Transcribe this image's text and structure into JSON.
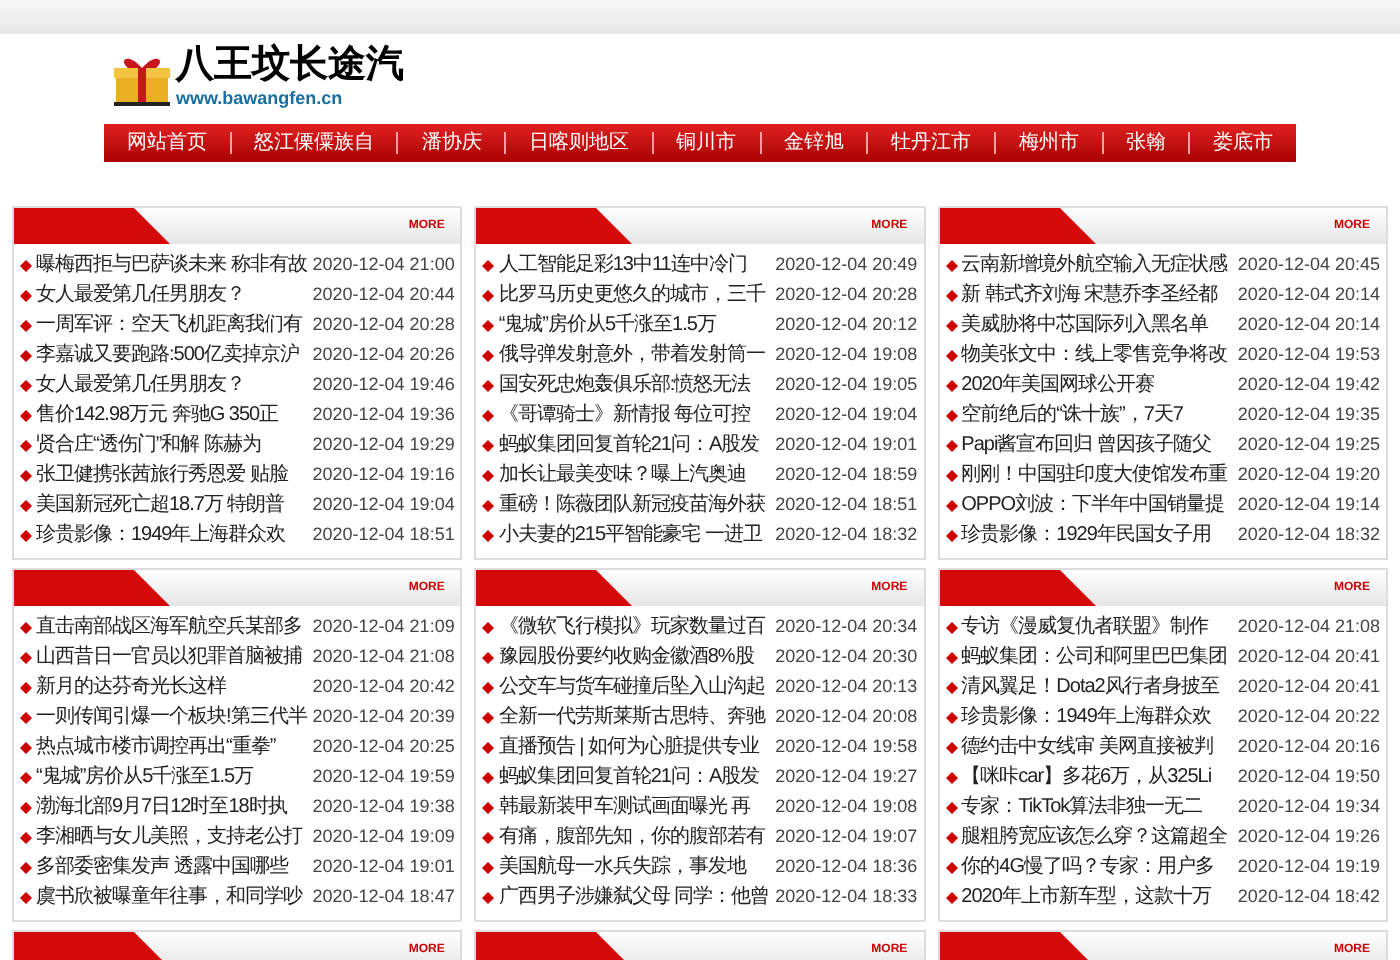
{
  "logo": {
    "title": "八王坟长途汽",
    "url": "www.bawangfen.cn"
  },
  "nav": [
    "网站首页",
    "怒江傈僳族自",
    "潘协庆",
    "日喀则地区",
    "铜川市",
    "金锌旭",
    "牡丹江市",
    "梅州市",
    "张翰",
    "娄底市"
  ],
  "panels": [
    {
      "more": "MORE",
      "items": [
        {
          "title": "曝梅西拒与巴萨谈未来 称非有故",
          "time": "2020-12-04 21:00"
        },
        {
          "title": "女人最爱第几任男朋友？",
          "time": "2020-12-04 20:44"
        },
        {
          "title": "一周军评：空天飞机距离我们有",
          "time": "2020-12-04 20:28"
        },
        {
          "title": "李嘉诚又要跑路:500亿卖掉京沪",
          "time": "2020-12-04 20:26"
        },
        {
          "title": "女人最爱第几任男朋友？",
          "time": "2020-12-04 19:46"
        },
        {
          "title": "售价142.98万元 奔驰G 350正",
          "time": "2020-12-04 19:36"
        },
        {
          "title": "贤合庄“透伤门”和解 陈赫为",
          "time": "2020-12-04 19:29"
        },
        {
          "title": "张卫健携张茜旅行秀恩爱 贴脸",
          "time": "2020-12-04 19:16"
        },
        {
          "title": "美国新冠死亡超18.7万 特朗普",
          "time": "2020-12-04 19:04"
        },
        {
          "title": "珍贵影像：1949年上海群众欢",
          "time": "2020-12-04 18:51"
        }
      ]
    },
    {
      "more": "MORE",
      "items": [
        {
          "title": "人工智能足彩13中11连中冷门",
          "time": "2020-12-04 20:49"
        },
        {
          "title": "比罗马历史更悠久的城市，三千",
          "time": "2020-12-04 20:28"
        },
        {
          "title": "“鬼城”房价从5千涨至1.5万",
          "time": "2020-12-04 20:12"
        },
        {
          "title": "俄导弹发射意外，带着发射筒一",
          "time": "2020-12-04 19:08"
        },
        {
          "title": "国安死忠炮轰俱乐部:愤怒无法",
          "time": "2020-12-04 19:05"
        },
        {
          "title": "《哥谭骑士》新情报 每位可控",
          "time": "2020-12-04 19:04"
        },
        {
          "title": "蚂蚁集团回复首轮21问：A股发",
          "time": "2020-12-04 19:01"
        },
        {
          "title": "加长让最美变味？曝上汽奥迪",
          "time": "2020-12-04 18:59"
        },
        {
          "title": "重磅！陈薇团队新冠疫苗海外获",
          "time": "2020-12-04 18:51"
        },
        {
          "title": "小夫妻的215平智能豪宅 一进卫",
          "time": "2020-12-04 18:32"
        }
      ]
    },
    {
      "more": "MORE",
      "items": [
        {
          "title": "云南新增境外航空输入无症状感",
          "time": "2020-12-04 20:45"
        },
        {
          "title": "新 韩式齐刘海 宋慧乔李圣经都",
          "time": "2020-12-04 20:14"
        },
        {
          "title": "美威胁将中芯国际列入黑名单",
          "time": "2020-12-04 20:14"
        },
        {
          "title": "物美张文中：线上零售竞争将改",
          "time": "2020-12-04 19:53"
        },
        {
          "title": "2020年美国网球公开赛",
          "time": "2020-12-04 19:42"
        },
        {
          "title": "空前绝后的“诛十族”，7天7",
          "time": "2020-12-04 19:35"
        },
        {
          "title": "Papi酱宣布回归 曾因孩子随父",
          "time": "2020-12-04 19:25"
        },
        {
          "title": "刚刚！中国驻印度大使馆发布重",
          "time": "2020-12-04 19:20"
        },
        {
          "title": "OPPO刘波：下半年中国销量提",
          "time": "2020-12-04 19:14"
        },
        {
          "title": "珍贵影像：1929年民国女子用",
          "time": "2020-12-04 18:32"
        }
      ]
    },
    {
      "more": "MORE",
      "items": [
        {
          "title": "直击南部战区海军航空兵某部多",
          "time": "2020-12-04 21:09"
        },
        {
          "title": "山西昔日一官员以犯罪首脑被捕",
          "time": "2020-12-04 21:08"
        },
        {
          "title": "新月的达芬奇光长这样",
          "time": "2020-12-04 20:42"
        },
        {
          "title": "一则传闻引爆一个板块!第三代半",
          "time": "2020-12-04 20:39"
        },
        {
          "title": "热点城市楼市调控再出“重拳”",
          "time": "2020-12-04 20:25"
        },
        {
          "title": "“鬼城”房价从5千涨至1.5万",
          "time": "2020-12-04 19:59"
        },
        {
          "title": "渤海北部9月7日12时至18时执",
          "time": "2020-12-04 19:38"
        },
        {
          "title": "李湘晒与女儿美照，支持老公打",
          "time": "2020-12-04 19:09"
        },
        {
          "title": "多部委密集发声 透露中国哪些",
          "time": "2020-12-04 19:01"
        },
        {
          "title": "虞书欣被曝童年往事，和同学吵",
          "time": "2020-12-04 18:47"
        }
      ]
    },
    {
      "more": "MORE",
      "items": [
        {
          "title": "《微软飞行模拟》玩家数量过百",
          "time": "2020-12-04 20:34"
        },
        {
          "title": "豫园股份要约收购金徽酒8%股",
          "time": "2020-12-04 20:30"
        },
        {
          "title": "公交车与货车碰撞后坠入山沟起",
          "time": "2020-12-04 20:13"
        },
        {
          "title": "全新一代劳斯莱斯古思特、奔驰",
          "time": "2020-12-04 20:08"
        },
        {
          "title": "直播预告 | 如何为心脏提供专业",
          "time": "2020-12-04 19:58"
        },
        {
          "title": "蚂蚁集团回复首轮21问：A股发",
          "time": "2020-12-04 19:27"
        },
        {
          "title": "韩最新装甲车测试画面曝光 再",
          "time": "2020-12-04 19:08"
        },
        {
          "title": "有痛，腹部先知，你的腹部若有",
          "time": "2020-12-04 19:07"
        },
        {
          "title": "美国航母一水兵失踪，事发地",
          "time": "2020-12-04 18:36"
        },
        {
          "title": "广西男子涉嫌弑父母 同学：他曾",
          "time": "2020-12-04 18:33"
        }
      ]
    },
    {
      "more": "MORE",
      "items": [
        {
          "title": "专访《漫威复仇者联盟》制作",
          "time": "2020-12-04 21:08"
        },
        {
          "title": "蚂蚁集团：公司和阿里巴巴集团",
          "time": "2020-12-04 20:41"
        },
        {
          "title": "清风翼足！Dota2风行者身披至",
          "time": "2020-12-04 20:41"
        },
        {
          "title": "珍贵影像：1949年上海群众欢",
          "time": "2020-12-04 20:22"
        },
        {
          "title": "德约击中女线审 美网直接被判",
          "time": "2020-12-04 20:16"
        },
        {
          "title": "【咪咔car】多花6万，从325Li",
          "time": "2020-12-04 19:50"
        },
        {
          "title": "专家：TikTok算法非独一无二",
          "time": "2020-12-04 19:34"
        },
        {
          "title": "腿粗胯宽应该怎么穿？这篇超全",
          "time": "2020-12-04 19:26"
        },
        {
          "title": "你的4G慢了吗？专家：用户多",
          "time": "2020-12-04 19:19"
        },
        {
          "title": "2020年上市新车型，这款十万",
          "time": "2020-12-04 18:42"
        }
      ]
    },
    {
      "more": "MORE"
    },
    {
      "more": "MORE"
    },
    {
      "more": "MORE"
    }
  ]
}
